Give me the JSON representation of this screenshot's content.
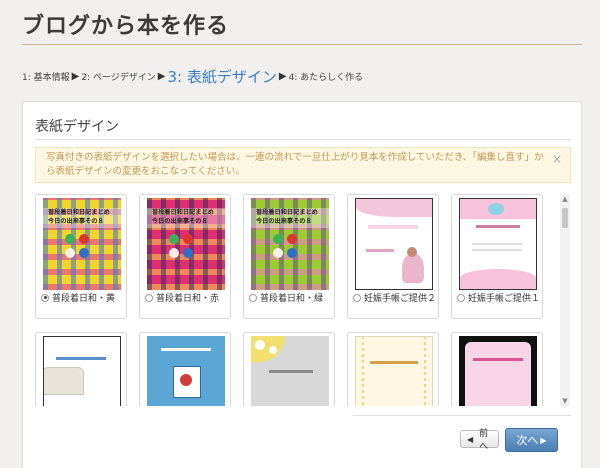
{
  "page": {
    "title": "ブログから本を作る"
  },
  "steps": [
    {
      "label": "1: 基本情報"
    },
    {
      "label": "2: ページデザイン"
    },
    {
      "label": "3: 表紙デザイン"
    },
    {
      "label": "4: あたらしく作る"
    }
  ],
  "panel": {
    "heading": "表紙デザイン",
    "alert_text": "写真付きの表紙デザインを選択したい場合は、一連の流れで一旦仕上がり見本を作成していただき、「編集し直す」から表紙デザインの変更をおこなってください。",
    "alert_close": "×"
  },
  "designs": [
    {
      "label": "普段着日和・黄",
      "selected": true,
      "cover_title_1": "普段着日和日記まとめ",
      "cover_title_2": "今日の出来事その８"
    },
    {
      "label": "普段着日和・赤",
      "selected": false,
      "cover_title_1": "普段着日和日記まとめ",
      "cover_title_2": "今日の出来事その８"
    },
    {
      "label": "普段着日和・緑",
      "selected": false,
      "cover_title_1": "普段着日和日記まとめ",
      "cover_title_2": "今日の出来事その８"
    },
    {
      "label": "妊娠手帳ご提供２",
      "selected": false
    },
    {
      "label": "妊娠手帳ご提供１",
      "selected": false
    },
    {
      "label": "",
      "selected": false
    },
    {
      "label": "",
      "selected": false
    },
    {
      "label": "",
      "selected": false
    },
    {
      "label": "",
      "selected": false
    },
    {
      "label": "",
      "selected": false
    }
  ],
  "buttons": {
    "prev_label": "前へ",
    "next_label": "次へ"
  },
  "icons": {
    "step_arrow": "chevron-right-icon",
    "prev": "chevron-left-icon",
    "next": "chevron-right-icon",
    "close": "close-icon"
  },
  "colors": {
    "accent": "#3b7fc1",
    "next_button": "#4a7eb5",
    "alert_bg": "#fcf7e3",
    "alert_text": "#c49a56"
  }
}
